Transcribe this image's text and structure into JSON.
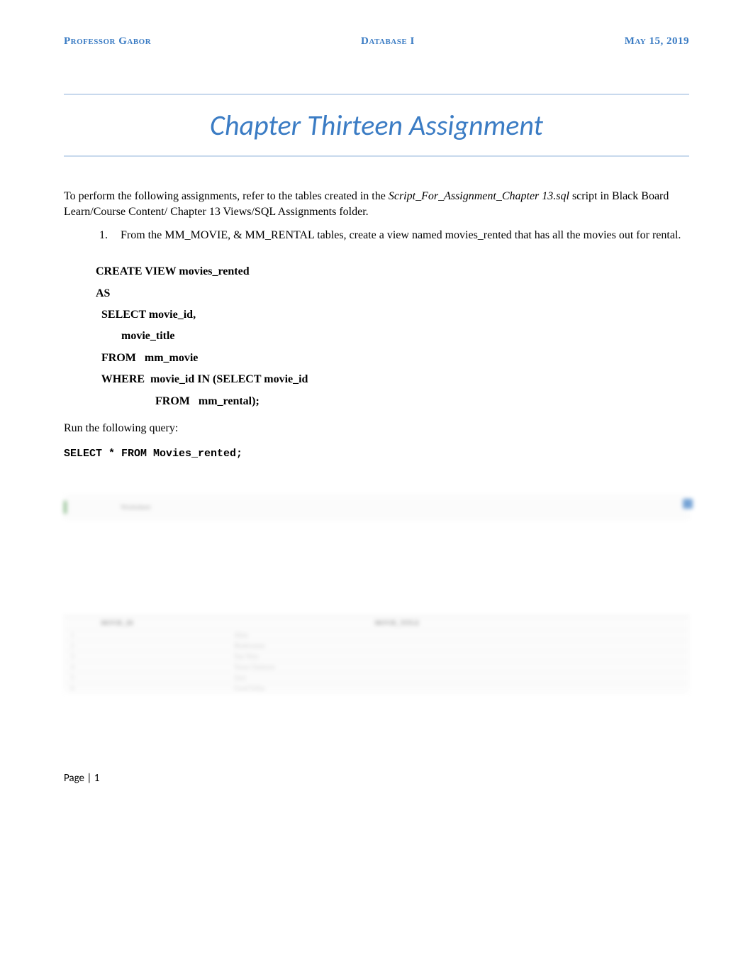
{
  "header": {
    "left": "Professor Gabor",
    "center": "Database I",
    "right": "May 15, 2019"
  },
  "title": "Chapter Thirteen Assignment",
  "intro": {
    "line1": "To perform the following assignments, refer to the tables created in the ",
    "italic_part": "Script_For_Assignment_Chapter 13.sql",
    "line1_cont": " script in Black Board Learn/Course Content/ Chapter 13 Views/SQL Assignments folder."
  },
  "list": {
    "item1": {
      "number": "1.",
      "text": "From the MM_MOVIE, & MM_RENTAL tables, create a view named movies_rented that has all the movies out for rental."
    }
  },
  "code": {
    "line1": "CREATE VIEW movies_rented",
    "line2": "AS",
    "line3": "  SELECT movie_id,",
    "line4": "         movie_title",
    "line5": "  FROM   mm_movie",
    "line6": "  WHERE  movie_id IN (SELECT movie_id",
    "line7": "                     FROM   mm_rental);"
  },
  "run_text": "Run the following query:",
  "query": "SELECT * FROM Movies_rented;",
  "screenshot": {
    "tab_label": "Worksheet",
    "col_a": "MOVIE_ID",
    "col_b": "MOVIE_TITLE",
    "rows": [
      {
        "a": "1",
        "b": "Alien"
      },
      {
        "a": "2",
        "b": "Bladerunner"
      },
      {
        "a": "3",
        "b": "Star Wars"
      },
      {
        "a": "4",
        "b": "Texas Chainsaw"
      },
      {
        "a": "5",
        "b": "Jaws"
      },
      {
        "a": "6",
        "b": "Good Fellas"
      }
    ]
  },
  "footer": "Page | 1"
}
